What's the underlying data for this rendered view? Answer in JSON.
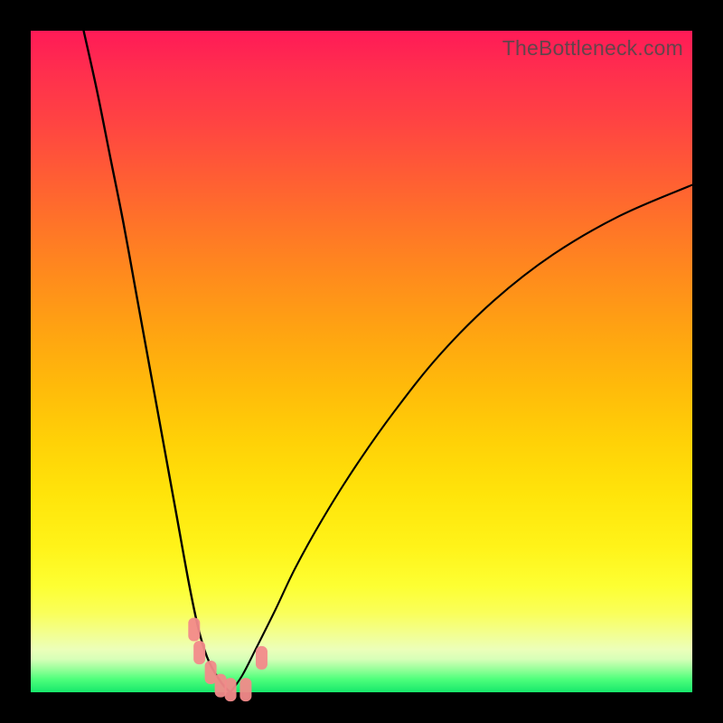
{
  "watermark": "TheBottleneck.com",
  "colors": {
    "marker": "#f28a8a",
    "curve": "#000000",
    "frame": "#000000"
  },
  "chart_data": {
    "type": "line",
    "title": "",
    "xlabel": "",
    "ylabel": "",
    "xlim": [
      0,
      100
    ],
    "ylim": [
      0,
      100
    ],
    "grid": false,
    "legend": false,
    "series": [
      {
        "name": "left-branch",
        "x": [
          8,
          10,
          12,
          14,
          16,
          18,
          20,
          22,
          24,
          25.5,
          27,
          29,
          30.2
        ],
        "y": [
          100,
          91,
          81,
          71,
          60,
          49,
          38,
          27,
          16,
          9,
          4.5,
          1.2,
          0
        ]
      },
      {
        "name": "right-branch",
        "x": [
          30.2,
          32,
          34,
          37,
          40,
          44,
          49,
          55,
          62,
          70,
          79,
          89,
          100
        ],
        "y": [
          0,
          2.6,
          6.5,
          12.5,
          18.8,
          26,
          34,
          42.5,
          51.2,
          59.2,
          66.2,
          72,
          76.7
        ]
      }
    ],
    "salmon_markers": {
      "comment": "pink rounded-rect markers near the valley bottom",
      "points": [
        {
          "x": 24.7,
          "y": 9.5
        },
        {
          "x": 25.5,
          "y": 6.0
        },
        {
          "x": 27.2,
          "y": 3.0
        },
        {
          "x": 28.7,
          "y": 1.0
        },
        {
          "x": 30.2,
          "y": 0.4
        },
        {
          "x": 32.5,
          "y": 0.4
        },
        {
          "x": 34.9,
          "y": 5.2
        }
      ]
    }
  }
}
